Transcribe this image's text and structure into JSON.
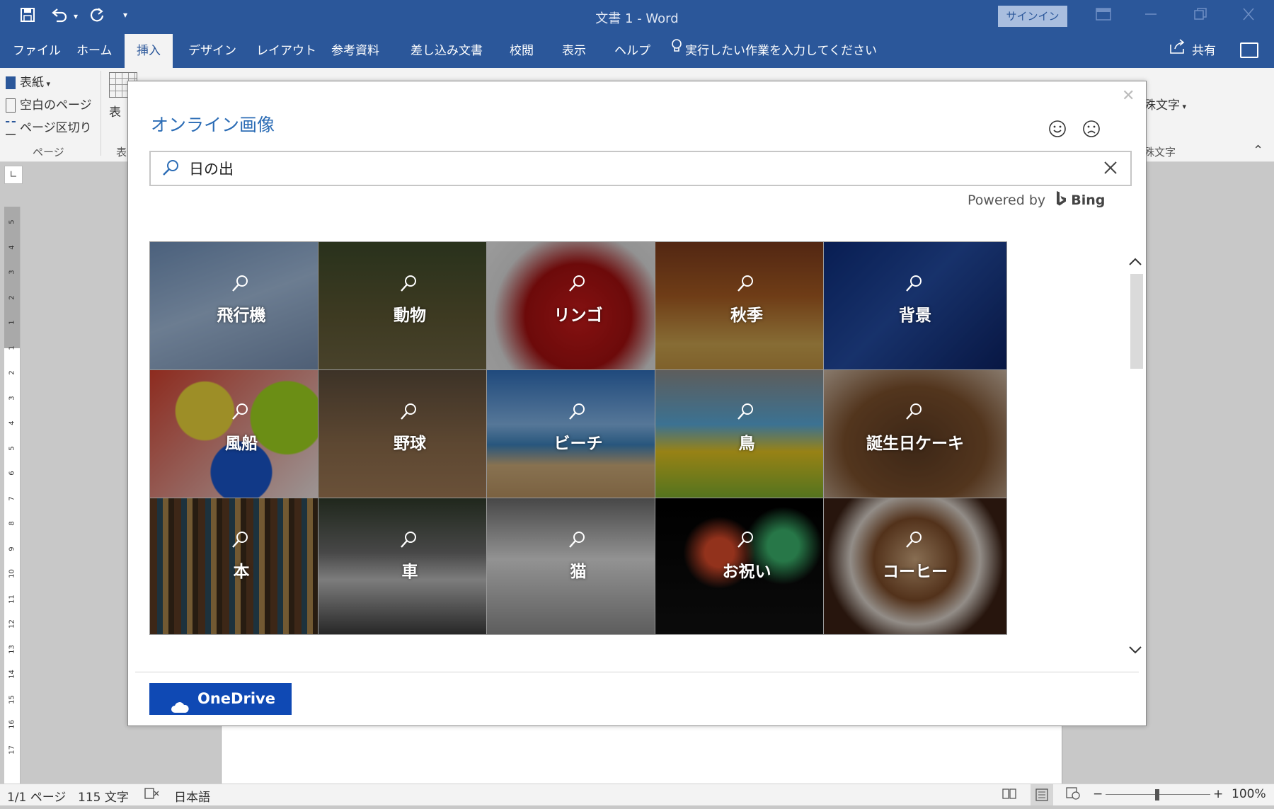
{
  "window": {
    "title": "文書 1  -  Word",
    "signin_label": "サインイン"
  },
  "ribbon": {
    "tabs": [
      {
        "label": "ファイル"
      },
      {
        "label": "ホーム"
      },
      {
        "label": "挿入"
      },
      {
        "label": "デザイン"
      },
      {
        "label": "レイアウト"
      },
      {
        "label": "参考資料"
      },
      {
        "label": "差し込み文書"
      },
      {
        "label": "校閲"
      },
      {
        "label": "表示"
      },
      {
        "label": "ヘルプ"
      }
    ],
    "active_tab": "挿入",
    "tellme": "実行したい作業を入力してください",
    "share": "共有",
    "pages_group": {
      "cover": "表紙",
      "blank": "空白のページ",
      "break": "ページ区切り",
      "group_label": "ページ"
    },
    "table_label": "表",
    "table_group": "表",
    "right_partial": "殊文字",
    "right_partial_group": "殊文字"
  },
  "dialog": {
    "title": "オンライン画像",
    "search_value": "日の出",
    "powered_by": "Powered by",
    "bing": "Bing",
    "categories": [
      {
        "label": "飛行機"
      },
      {
        "label": "動物"
      },
      {
        "label": "リンゴ"
      },
      {
        "label": "秋季"
      },
      {
        "label": "背景"
      },
      {
        "label": "風船"
      },
      {
        "label": "野球"
      },
      {
        "label": "ビーチ"
      },
      {
        "label": "鳥"
      },
      {
        "label": "誕生日ケーキ"
      },
      {
        "label": "本"
      },
      {
        "label": "車"
      },
      {
        "label": "猫"
      },
      {
        "label": "お祝い"
      },
      {
        "label": "コーヒー"
      }
    ],
    "onedrive_label": "OneDrive"
  },
  "statusbar": {
    "page": "1/1 ページ",
    "words": "115 文字",
    "language": "日本語",
    "zoom": "100%"
  },
  "ruler": {
    "numbers": [
      "5",
      "4",
      "3",
      "2",
      "1",
      "1",
      "2",
      "3",
      "4",
      "5",
      "6",
      "7",
      "8",
      "9",
      "10",
      "11",
      "12",
      "13",
      "14",
      "15",
      "16",
      "17"
    ]
  },
  "colors": {
    "brand": "#2b579a",
    "onedrive": "#0f49b4",
    "dialog_title": "#2b6cb5"
  }
}
